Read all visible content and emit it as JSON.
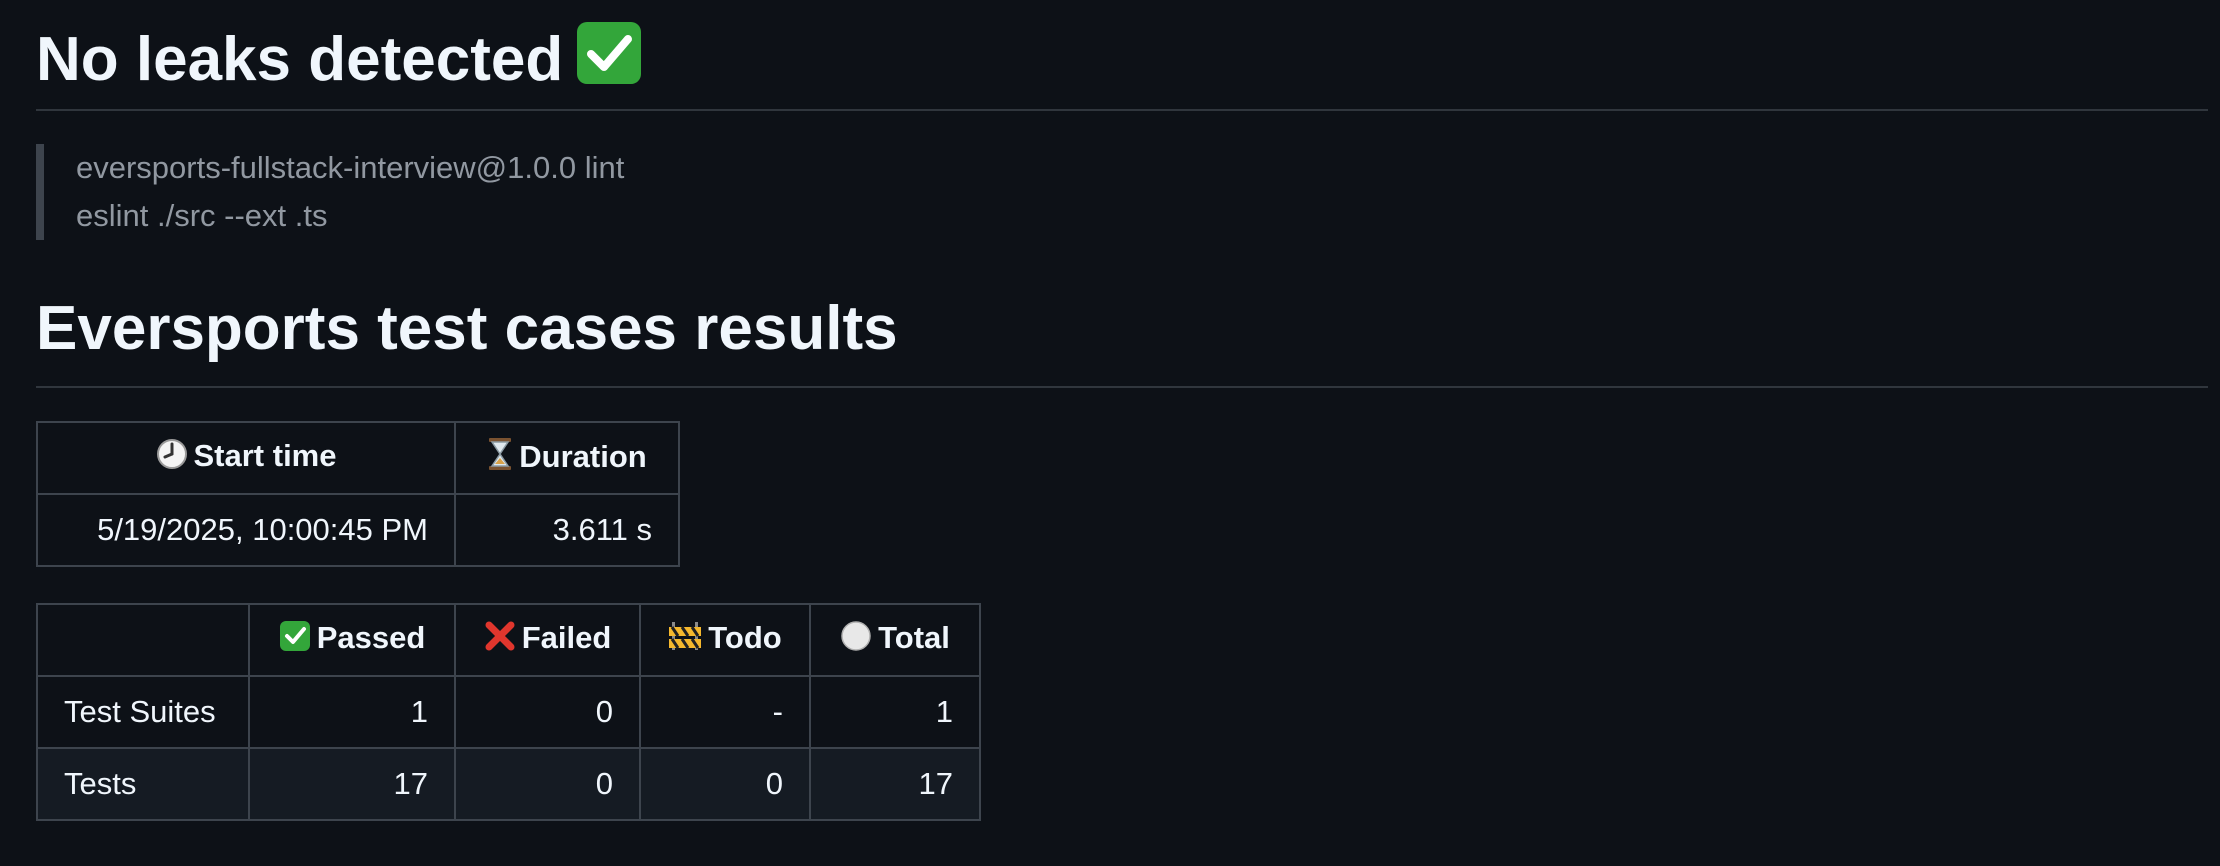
{
  "leaks": {
    "heading": "No leaks detected",
    "status_icon": "check-mark-button-icon"
  },
  "lint": {
    "line1": "eversports-fullstack-interview@1.0.0 lint",
    "line2": "eslint ./src --ext .ts"
  },
  "results": {
    "heading": "Eversports test cases results"
  },
  "timing": {
    "start_header": "Start time",
    "start_icon": "clock-icon",
    "duration_header": "Duration",
    "duration_icon": "hourglass-icon",
    "start_value": "5/19/2025, 10:00:45 PM",
    "duration_value": "3.611 s"
  },
  "summary": {
    "headers": {
      "passed": "Passed",
      "failed": "Failed",
      "todo": "Todo",
      "total": "Total"
    },
    "header_icons": {
      "passed": "check-mark-button-icon",
      "failed": "cross-mark-icon",
      "todo": "construction-icon",
      "total": "white-circle-icon"
    },
    "rows": [
      {
        "label": "Test Suites",
        "passed": "1",
        "failed": "0",
        "todo": "-",
        "total": "1"
      },
      {
        "label": "Tests",
        "passed": "17",
        "failed": "0",
        "todo": "0",
        "total": "17"
      }
    ]
  },
  "colors": {
    "background": "#0d1117",
    "text": "#f0f6fc",
    "muted": "#9198a1",
    "border": "#3d444d",
    "check_green": "#33a63a",
    "cross_red": "#e0362d"
  }
}
